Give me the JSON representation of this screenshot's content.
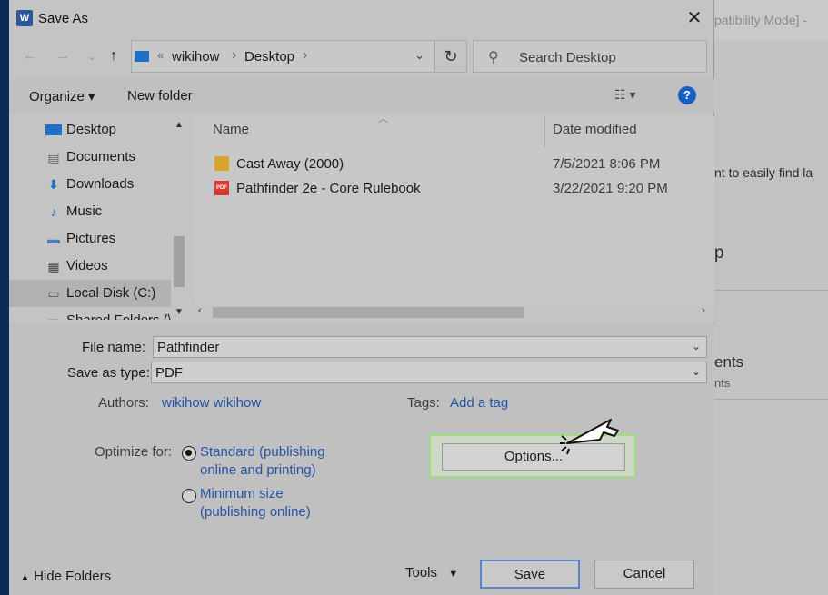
{
  "background_window": {
    "title_fragment": "patibility Mode]  -",
    "text_1": "nt to easily find la",
    "text_2": "p",
    "text_3": "ents",
    "text_4": "nts"
  },
  "dialog": {
    "title": "Save As",
    "app_icon_letter": "W",
    "close_glyph": "✕"
  },
  "navigation": {
    "back_glyph": "←",
    "forward_glyph": "→",
    "recent_glyph": "⌄",
    "up_glyph": "↑",
    "address": {
      "overflow": "«",
      "segments": [
        "wikihow",
        "Desktop"
      ],
      "separator": "›"
    },
    "refresh_glyph": "↻",
    "search_placeholder": "Search Desktop"
  },
  "toolbar": {
    "organize": "Organize ▾",
    "new_folder": "New folder",
    "help_glyph": "?"
  },
  "nav_pane": {
    "items": [
      {
        "label": "Desktop",
        "icon": "desktop-icon"
      },
      {
        "label": "Documents",
        "icon": "documents-icon"
      },
      {
        "label": "Downloads",
        "icon": "downloads-icon"
      },
      {
        "label": "Music",
        "icon": "music-icon"
      },
      {
        "label": "Pictures",
        "icon": "pictures-icon"
      },
      {
        "label": "Videos",
        "icon": "videos-icon"
      },
      {
        "label": "Local Disk (C:)",
        "icon": "disk-icon",
        "selected": true
      },
      {
        "label": "Shared Folders (\\",
        "icon": "shared-folder-icon"
      }
    ]
  },
  "file_list": {
    "columns": {
      "name": "Name",
      "date": "Date modified"
    },
    "files": [
      {
        "name": "Cast Away (2000)",
        "date": "7/5/2021 8:06 PM",
        "type": "folder"
      },
      {
        "name": "Pathfinder 2e - Core Rulebook",
        "date": "3/22/2021 9:20 PM",
        "type": "pdf"
      }
    ]
  },
  "form": {
    "file_name_label": "File name:",
    "file_name_value": "Pathfinder",
    "save_type_label": "Save as type:",
    "save_type_value": "PDF",
    "authors_label": "Authors:",
    "authors_value": "wikihow wikihow",
    "tags_label": "Tags:",
    "tags_value": "Add a tag",
    "optimize_label": "Optimize for:",
    "option_standard_line1": "Standard (publishing",
    "option_standard_line2": "online and printing)",
    "option_minimum_line1": "Minimum size",
    "option_minimum_line2": "(publishing online)",
    "options_button": "Options..."
  },
  "footer": {
    "hide_folders": "Hide Folders",
    "tools": "Tools",
    "save": "Save",
    "cancel": "Cancel"
  },
  "colors": {
    "accent_link": "#2653a8",
    "highlight_green": "#9fdc7f",
    "word_blue": "#2b579a"
  }
}
